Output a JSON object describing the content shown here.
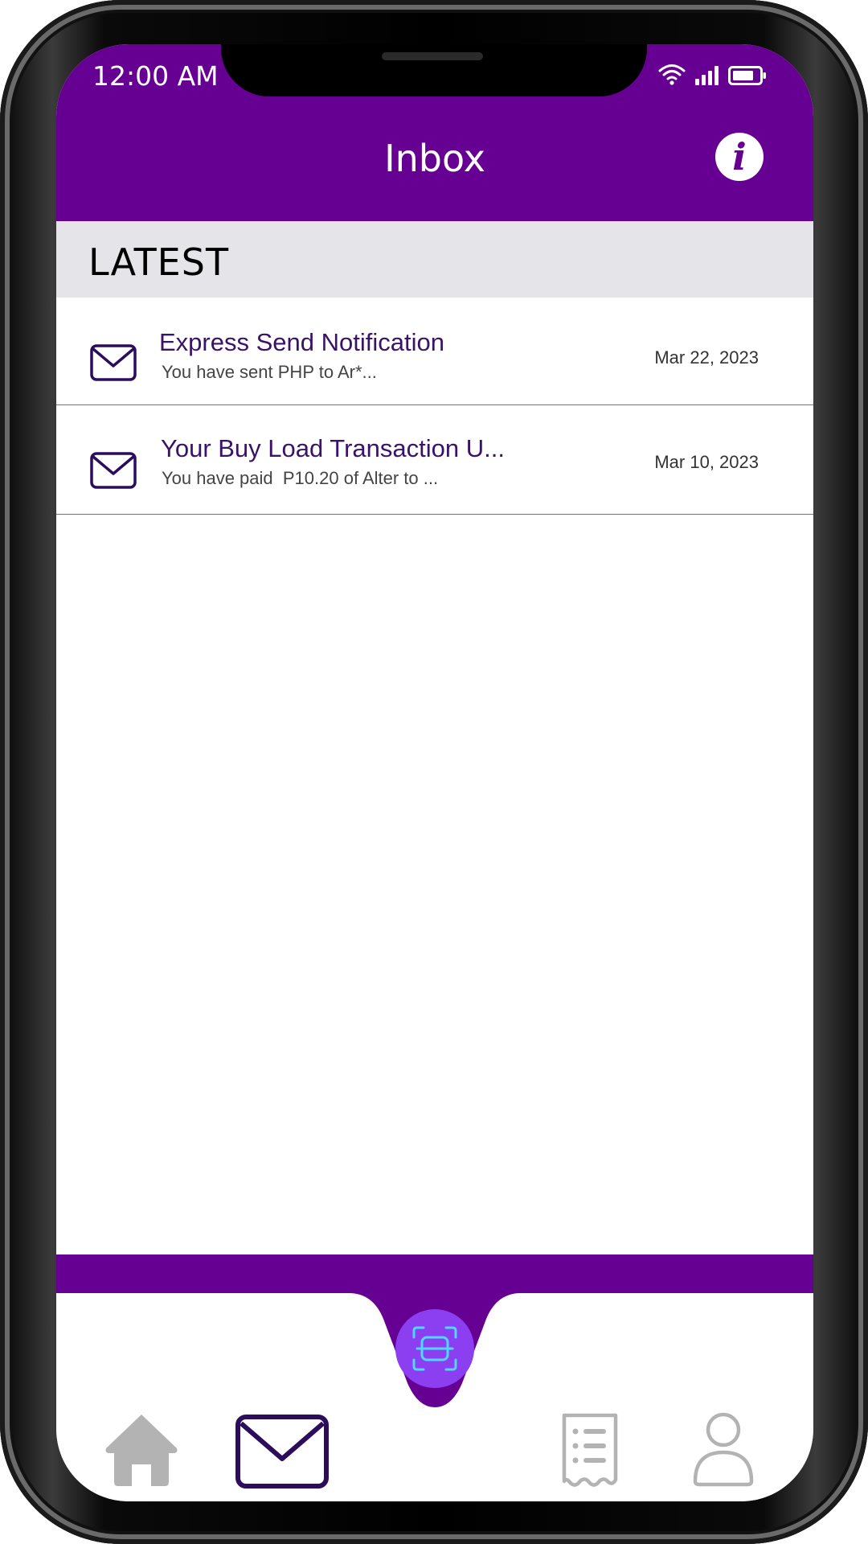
{
  "status_bar": {
    "time": "12:00 AM",
    "icons": [
      "wifi-icon",
      "signal-icon",
      "battery-icon"
    ]
  },
  "header": {
    "title": "Inbox",
    "info_icon": "info-icon",
    "info_glyph": "i"
  },
  "section": {
    "label": "LATEST"
  },
  "messages": [
    {
      "title": "Express Send Notification",
      "preview": "You have sent PHP to Ar*...",
      "date": "Mar 22, 2023",
      "icon": "envelope-icon"
    },
    {
      "title": "Your Buy Load Transaction U...",
      "preview": "You have paid  P10.20 of Alter to ...",
      "date": "Mar 10, 2023",
      "icon": "envelope-icon"
    }
  ],
  "bottom_nav": {
    "items": [
      {
        "icon": "home-icon",
        "active": false
      },
      {
        "icon": "mail-icon",
        "active": true
      },
      {
        "icon": "scan-icon",
        "active": false
      },
      {
        "icon": "receipt-icon",
        "active": false
      },
      {
        "icon": "profile-icon",
        "active": false
      }
    ]
  },
  "colors": {
    "brand_purple": "#660092",
    "scan_button": "#8b3ff0",
    "active_icon": "#2b0d5c",
    "inactive_icon": "#b3b3b3",
    "divider": "#5a6be0",
    "section_bg": "#e5e4e9"
  }
}
